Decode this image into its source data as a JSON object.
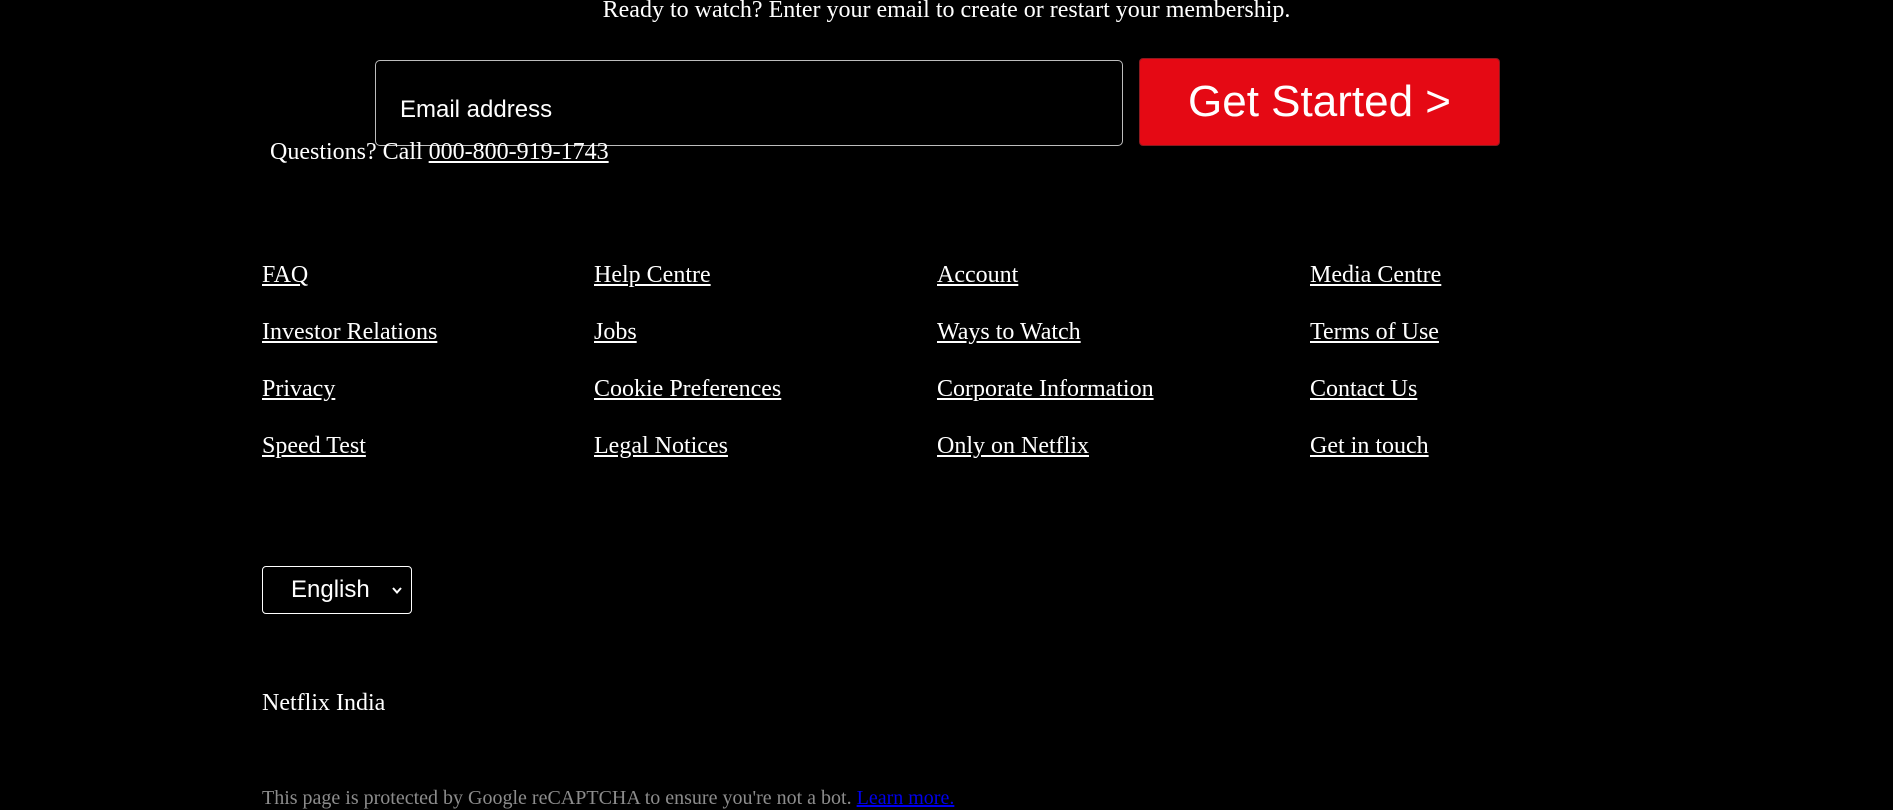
{
  "membership_cta": {
    "text": "Ready to watch? Enter your email to create or restart your membership.",
    "email_label": "Email address",
    "button_label": "Get Started >",
    "button_color": "#e50914"
  },
  "contact": {
    "prefix": "Questions? Call ",
    "phone": "000-800-919-1743"
  },
  "footer_links": {
    "col1": [
      "FAQ",
      "Investor Relations",
      "Privacy",
      "Speed Test"
    ],
    "col2": [
      "Help Centre",
      "Jobs",
      "Cookie Preferences",
      "Legal Notices"
    ],
    "col3": [
      "Account",
      "Ways to Watch",
      "Corporate Information",
      "Only on Netflix"
    ],
    "col4": [
      "Media Centre",
      "Terms of Use",
      "Contact Us",
      "Get in touch"
    ]
  },
  "language": {
    "selected": "English",
    "icon": "chevron-down-icon"
  },
  "country_label": "Netflix India",
  "recaptcha": {
    "text": "This page is protected by Google reCAPTCHA to ensure you're not a bot. ",
    "link": "Learn more."
  }
}
